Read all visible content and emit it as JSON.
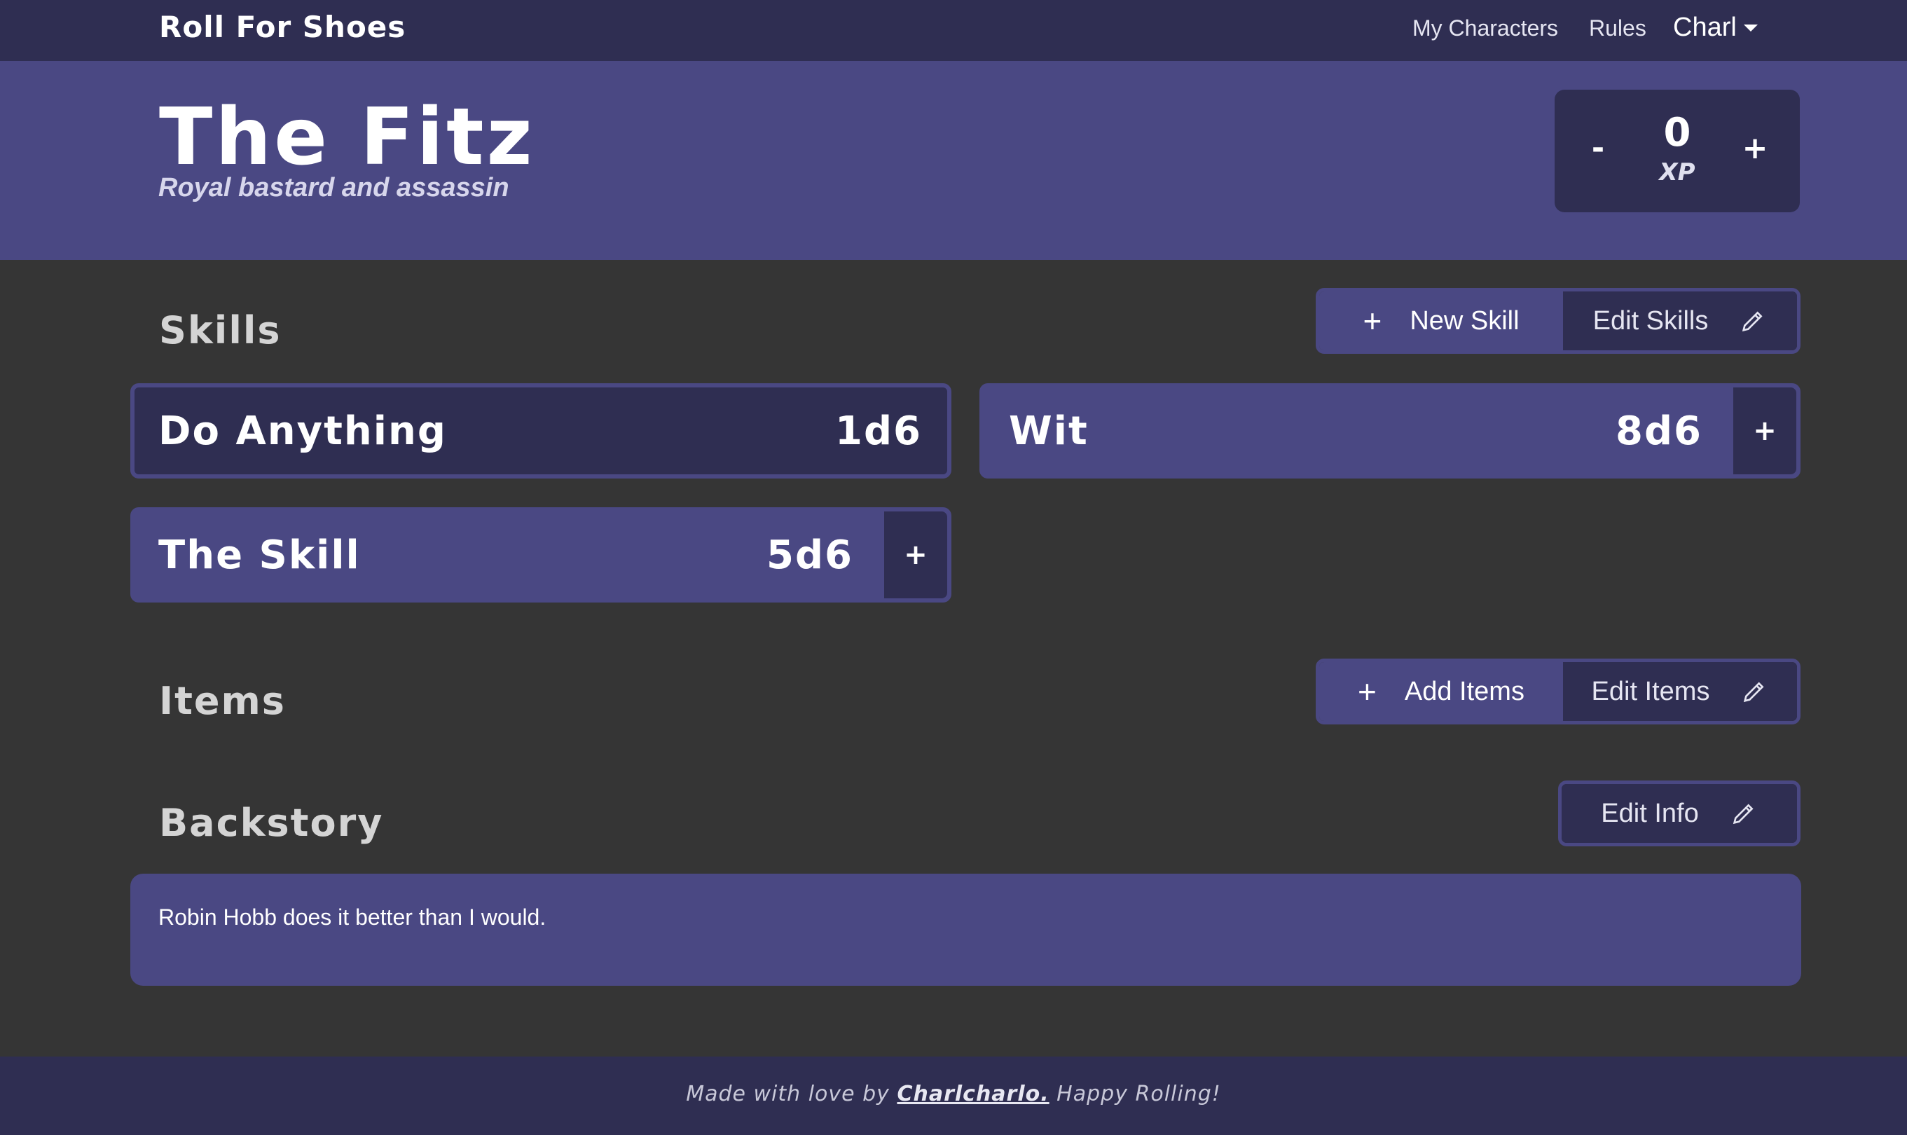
{
  "navbar": {
    "brand": "Roll For Shoes",
    "links": [
      "My Characters",
      "Rules"
    ],
    "user": "Charl"
  },
  "character": {
    "name": "The Fitz",
    "description": "Royal bastard and assassin",
    "xp_value": "0",
    "xp_label": "XP",
    "xp_minus": "-",
    "xp_plus": "+"
  },
  "skills_section": {
    "title": "Skills",
    "new_label": "New Skill",
    "edit_label": "Edit Skills",
    "skills": [
      {
        "name": "Do Anything",
        "dice": "1d6"
      },
      {
        "name": "Wit",
        "dice": "8d6",
        "plus": "+"
      },
      {
        "name": "The Skill",
        "dice": "5d6",
        "plus": "+"
      }
    ]
  },
  "items_section": {
    "title": "Items",
    "add_label": "Add Items",
    "edit_label": "Edit Items"
  },
  "backstory_section": {
    "title": "Backstory",
    "edit_label": "Edit Info",
    "text": "Robin Hobb does it better than I would."
  },
  "footer": {
    "prefix": "Made with love by ",
    "link": "Charlcharlo.",
    "suffix": " Happy Rolling!"
  },
  "colors": {
    "navbar": "#2f2e52",
    "accent": "#4a4883",
    "background": "#353535"
  }
}
